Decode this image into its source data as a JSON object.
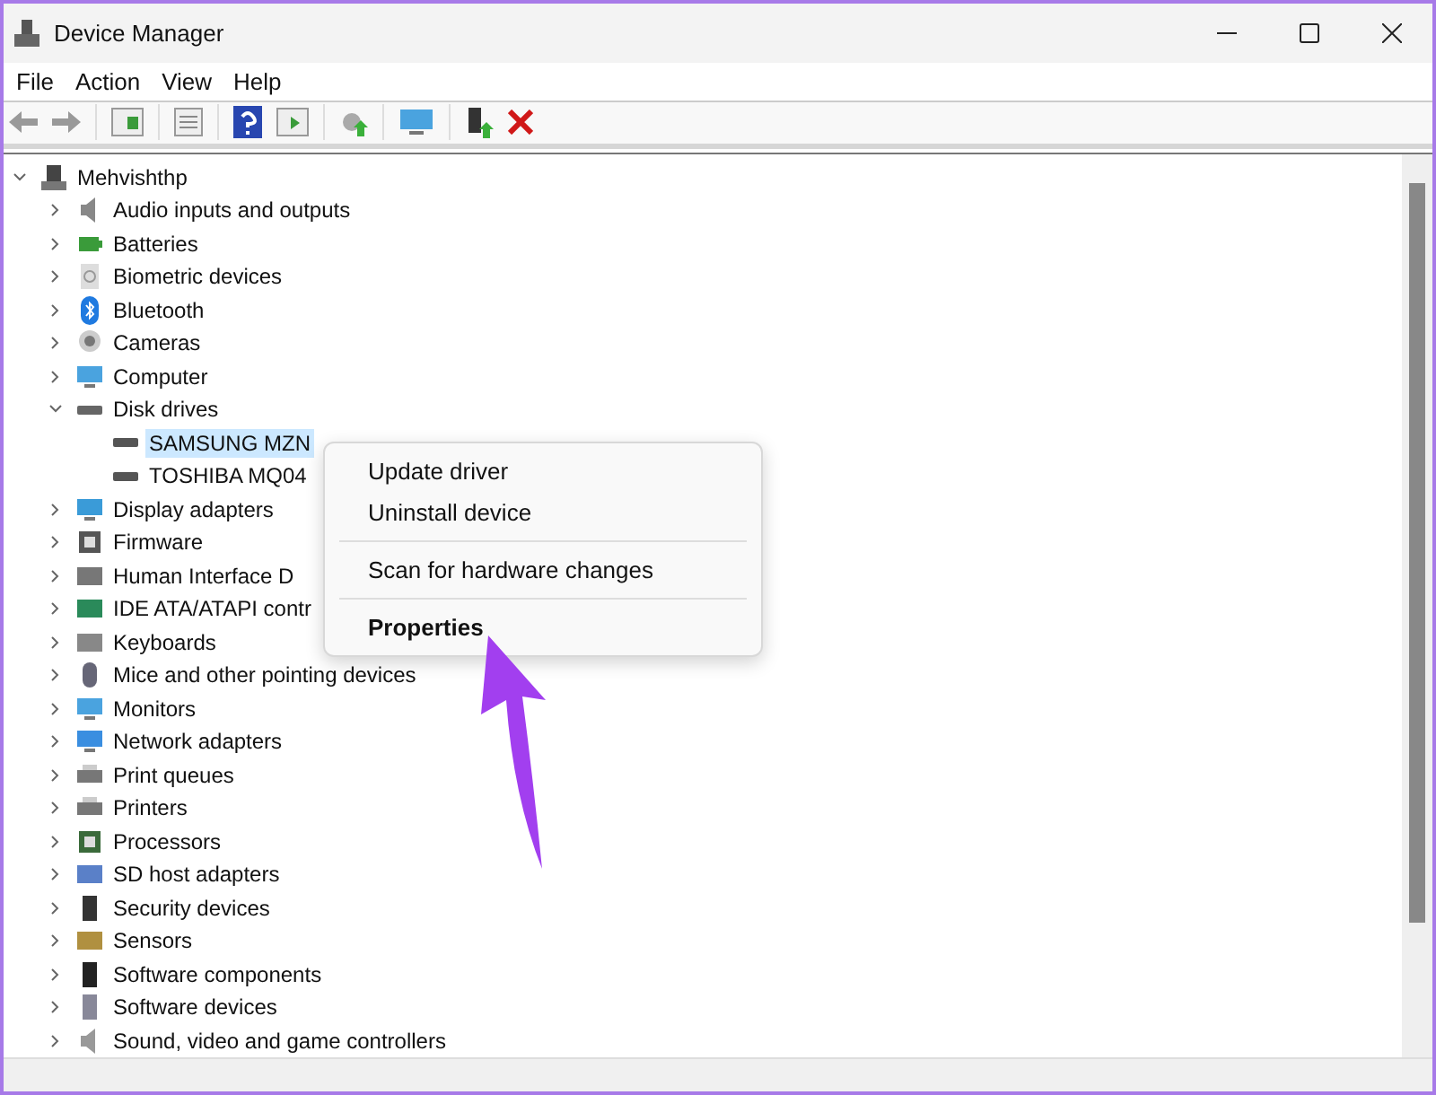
{
  "window": {
    "title": "Device Manager"
  },
  "menu": [
    {
      "label": "File"
    },
    {
      "label": "Action"
    },
    {
      "label": "View"
    },
    {
      "label": "Help"
    }
  ],
  "tree": {
    "label": "Mehvishthp",
    "expanded": true,
    "children": [
      {
        "label": "Audio inputs and outputs",
        "expanded": false
      },
      {
        "label": "Batteries",
        "expanded": false
      },
      {
        "label": "Biometric devices",
        "expanded": false
      },
      {
        "label": "Bluetooth",
        "expanded": false
      },
      {
        "label": "Cameras",
        "expanded": false
      },
      {
        "label": "Computer",
        "expanded": false
      },
      {
        "label": "Disk drives",
        "expanded": true,
        "children": [
          {
            "label": "SAMSUNG MZN",
            "selected": true
          },
          {
            "label": "TOSHIBA MQ04",
            "selected": false
          }
        ]
      },
      {
        "label": "Display adapters",
        "expanded": false
      },
      {
        "label": "Firmware",
        "expanded": false
      },
      {
        "label": "Human Interface D",
        "expanded": false
      },
      {
        "label": "IDE ATA/ATAPI contr",
        "expanded": false
      },
      {
        "label": "Keyboards",
        "expanded": false
      },
      {
        "label": "Mice and other pointing devices",
        "expanded": false
      },
      {
        "label": "Monitors",
        "expanded": false
      },
      {
        "label": "Network adapters",
        "expanded": false
      },
      {
        "label": "Print queues",
        "expanded": false
      },
      {
        "label": "Printers",
        "expanded": false
      },
      {
        "label": "Processors",
        "expanded": false
      },
      {
        "label": "SD host adapters",
        "expanded": false
      },
      {
        "label": "Security devices",
        "expanded": false
      },
      {
        "label": "Sensors",
        "expanded": false
      },
      {
        "label": "Software components",
        "expanded": false
      },
      {
        "label": "Software devices",
        "expanded": false
      },
      {
        "label": "Sound, video and game controllers",
        "expanded": false
      }
    ]
  },
  "context_menu": [
    {
      "kind": "item",
      "label": "Update driver",
      "bold": false
    },
    {
      "kind": "item",
      "label": "Uninstall device",
      "bold": false
    },
    {
      "kind": "separator"
    },
    {
      "kind": "item",
      "label": "Scan for hardware changes",
      "bold": false
    },
    {
      "kind": "separator"
    },
    {
      "kind": "item",
      "label": "Properties",
      "bold": true
    }
  ]
}
